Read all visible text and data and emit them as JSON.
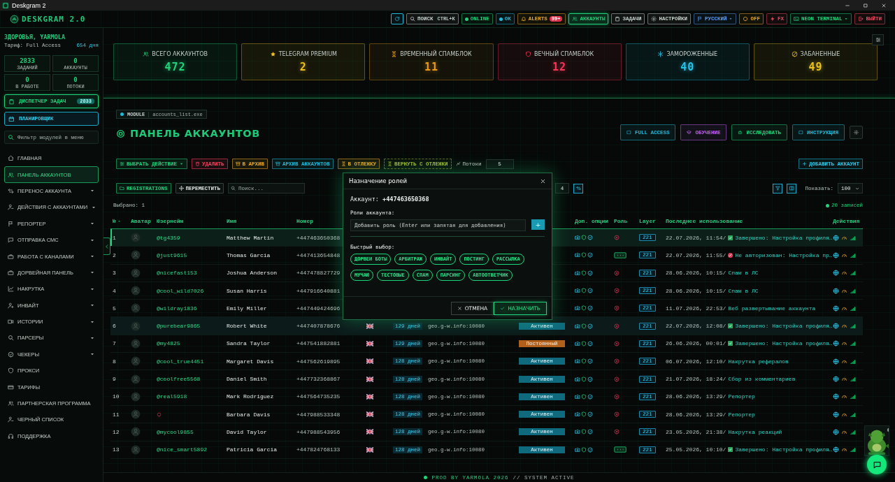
{
  "window": {
    "title": "Deskgram 2"
  },
  "header": {
    "logo": "DESKGRAM 2.0",
    "buttons": [
      {
        "color": "#22b8d8",
        "selected": false,
        "dropdown": false
      },
      {
        "label": "ПОИСК",
        "shortcut": "CTRL+K",
        "color": "#c8d2cd",
        "selected": false,
        "dropdown": false
      },
      {
        "label": "ONLINE",
        "color": "#22d07a",
        "selected": false,
        "dropdown": false
      },
      {
        "label": "OK",
        "color": "#22b8d8",
        "selected": false,
        "dropdown": false
      },
      {
        "label": "ALERTS",
        "badge": "99+",
        "color": "#e8a828",
        "selected": false,
        "dropdown": false
      },
      {
        "label": "АККАУНТЫ",
        "color": "#22d07a",
        "selected": true,
        "dropdown": false
      },
      {
        "label": "ЗАДАЧИ",
        "color": "#c8d2cd",
        "selected": false,
        "dropdown": false
      },
      {
        "label": "НАСТРОЙКИ",
        "color": "#c8d2cd",
        "selected": false,
        "dropdown": false
      },
      {
        "label": "РУССКИЙ",
        "color": "#5a9cf0",
        "selected": false,
        "dropdown": true
      },
      {
        "label": "OFF",
        "color": "#e8a828",
        "selected": false,
        "dropdown": false
      },
      {
        "label": "FX",
        "color": "#f04860",
        "selected": false,
        "dropdown": false
      },
      {
        "label": "NEON TERMINAL",
        "color": "#22d07a",
        "selected": false,
        "dropdown": true
      },
      {
        "label": "ВЫЙТИ",
        "color": "#f04860",
        "selected": false,
        "dropdown": false
      }
    ]
  },
  "sidebar": {
    "greeting": "ЗДОРОВЬЯ, YARMOLA",
    "plan": "Тариф: Full Access",
    "days_left": "654 дня",
    "stats": [
      {
        "value": "2833",
        "label": "ЗАДАНИЙ"
      },
      {
        "value": "0",
        "label": "АККАУНТЫ"
      },
      {
        "value": "0",
        "label": "В РАБОТЕ"
      },
      {
        "value": "0",
        "label": "ПОТОКИ"
      }
    ],
    "dispatcher": {
      "label": "ДИСПЕТЧЕР ЗАДАЧ",
      "badge": "2833"
    },
    "planner": {
      "label": "ПЛАНИРОВЩИК"
    },
    "filter": {
      "placeholder": "Фильтр модулей в меню"
    },
    "items": [
      {
        "label": "ГЛАВНАЯ",
        "selected": false,
        "has_submenu": false
      },
      {
        "label": "ПАНЕЛЬ АККАУНТОВ",
        "selected": true,
        "has_submenu": false
      },
      {
        "label": "ПЕРЕНОС АККАУНТА",
        "selected": false,
        "has_submenu": true
      },
      {
        "label": "ДЕЙСТВИЯ С АККАУНТАМИ",
        "selected": false,
        "has_submenu": true
      },
      {
        "label": "РЕПОРТЕР",
        "selected": false,
        "has_submenu": true
      },
      {
        "label": "ОТПРАВКА СМС",
        "selected": false,
        "has_submenu": true
      },
      {
        "label": "РАБОТА С КАНАЛАМИ",
        "selected": false,
        "has_submenu": true
      },
      {
        "label": "ДОРВЕЙНАЯ ПАНЕЛЬ",
        "selected": false,
        "has_submenu": true
      },
      {
        "label": "НАКРУТКА",
        "selected": false,
        "has_submenu": true
      },
      {
        "label": "ИНВАЙТ",
        "selected": false,
        "has_submenu": true
      },
      {
        "label": "ИСТОРИИ",
        "selected": false,
        "has_submenu": true
      },
      {
        "label": "ПАРСЕРЫ",
        "selected": false,
        "has_submenu": true
      },
      {
        "label": "ЧЕКЕРЫ",
        "selected": false,
        "has_submenu": true
      },
      {
        "label": "ПРОКСИ",
        "selected": false,
        "has_submenu": false
      },
      {
        "label": "ТАРИФЫ",
        "selected": false,
        "has_submenu": false
      },
      {
        "label": "ПАРТНЕРСКАЯ ПРОГРАММА",
        "selected": false,
        "has_submenu": false
      },
      {
        "label": "ЧЕРНЫЙ СПИСОК",
        "selected": false,
        "has_submenu": false
      },
      {
        "label": "ПОДДЕРЖКА",
        "selected": false,
        "has_submenu": false
      }
    ]
  },
  "stat_cards": [
    {
      "label": "ВСЕГО АККАУНТОВ",
      "value": "472",
      "color": "#1ed47a"
    },
    {
      "label": "TELEGRAM PREMIUM",
      "value": "2",
      "color": "#f0c020"
    },
    {
      "label": "ВРЕМЕННЫЙ СПАМБЛОК",
      "value": "11",
      "color": "#e89a18"
    },
    {
      "label": "ВЕЧНЫЙ СПАМБЛОК",
      "value": "12",
      "color": "#ff3355"
    },
    {
      "label": "ЗАМОРОЖЕННЫЕ",
      "value": "40",
      "color": "#22c4e8"
    },
    {
      "label": "ЗАБАНЕННЫЕ",
      "value": "49",
      "color": "#e8c020"
    }
  ],
  "panel": {
    "module_label": "MODULE",
    "module_file": "accounts_list.exe",
    "title": "ПАНЕЛЬ АККАУНТОВ",
    "actions": [
      {
        "label": "FULL ACCESS",
        "color": "#22b8d8"
      },
      {
        "label": "ОБУЧЕНИЕ",
        "color": "#c060f0"
      },
      {
        "label": "ИССЛЕДОВАТЬ",
        "color": "#22d07a"
      },
      {
        "label": "ИНСТРУКЦИЯ",
        "color": "#22b8d8"
      }
    ],
    "toolbar": [
      {
        "label": "ВЫБРАТЬ ДЕЙСТВИЕ",
        "color": "#22d07a",
        "disabled": false
      },
      {
        "label": "УДАЛИТЬ",
        "color": "#ff4060",
        "disabled": false
      },
      {
        "label": "В АРХИВ",
        "color": "#e8a828",
        "disabled": false
      },
      {
        "label": "АРХИВ АККАУНТОВ",
        "color": "#22b8d8",
        "disabled": false
      },
      {
        "label": "В ОТЛЕЖКУ",
        "color": "#e8a828",
        "disabled": false
      },
      {
        "label": "ВЕРНУТЬ С ОТЛЕЖКИ",
        "color": "#a0b830",
        "disabled": true
      }
    ],
    "threads_label": "Потоки",
    "threads_value": "5",
    "add_button": "ДОБАВИТЬ АККАУНТ",
    "folder_button": "REGISTRATIONS",
    "move_button": "ПЕРЕМЕСТИТЬ",
    "search_placeholder": "Поиск...",
    "page_value": "4",
    "show_label": "Показать:",
    "show_value": "100",
    "selected_count": "Выбрано: 1",
    "records": "20 записей"
  },
  "table": {
    "columns": [
      "№",
      "Аватар",
      "Юзернейм",
      "Имя",
      "Номер",
      "Доп. опции",
      "Роль",
      "Layer",
      "Последнее использование",
      "Действия"
    ],
    "rows": [
      {
        "number": "1",
        "username": "@tg4359",
        "name": "Matthew Martin",
        "phone": "+447463650368",
        "role_assigned": false,
        "layer": "221",
        "date": "22.07.2026, 11:54/",
        "task": {
          "kind": "done",
          "text": "Завершено: Настройка профиля…"
        },
        "selected": true,
        "hovered": false
      },
      {
        "number": "2",
        "username": "@just9615",
        "name": "Thomas Garcia",
        "phone": "+447413654848",
        "role_assigned": true,
        "layer": "221",
        "date": "22.07.2026, 11:55/",
        "task": {
          "kind": "error",
          "text": "Не авторизован: Настройка пр…"
        },
        "selected": false,
        "hovered": false
      },
      {
        "number": "3",
        "username": "@nicefast153",
        "name": "Joshua Anderson",
        "phone": "+447478827729",
        "role_assigned": false,
        "layer": "221",
        "date": "28.06.2026, 10:15/",
        "task": {
          "kind": "plain",
          "text": "Спам в ЛС"
        },
        "selected": false,
        "hovered": false
      },
      {
        "number": "4",
        "username": "@cool_wild7026",
        "name": "Susan Harris",
        "phone": "+447916640881",
        "role_assigned": false,
        "layer": "221",
        "date": "28.06.2026, 10:15/",
        "task": {
          "kind": "plain",
          "text": "Спам в ЛС"
        },
        "selected": false,
        "hovered": false
      },
      {
        "number": "5",
        "username": "@wildray1836",
        "name": "Emily Miller",
        "phone": "+447449424696",
        "role_assigned": false,
        "layer": "221",
        "date": "11.07.2026, 22:53/",
        "task": {
          "kind": "plain",
          "text": "Веб развертывание аккаунта"
        },
        "selected": false,
        "hovered": false
      },
      {
        "number": "6",
        "username": "@purebear9865",
        "name": "Robert White",
        "phone": "+447407878676",
        "days": "129 дней",
        "proxy": "geo.g-w.info:10080",
        "status": {
          "text": "Активен",
          "kind": "active"
        },
        "role_assigned": false,
        "layer": "221",
        "date": "22.07.2026, 12:08/",
        "task": {
          "kind": "done",
          "text": "Завершено: Настройка профиля…"
        },
        "selected": false,
        "hovered": true
      },
      {
        "number": "7",
        "username": "@my4825",
        "name": "Sandra Taylor",
        "phone": "+447541882881",
        "days": "129 дней",
        "proxy": "geo.g-w.info:10080",
        "status": {
          "text": "Постоянный",
          "kind": "permanent"
        },
        "role_assigned": false,
        "layer": "221",
        "date": "26.06.2026, 00:01/",
        "task": {
          "kind": "done",
          "text": "Завершено: Настройка профиля…"
        },
        "selected": false,
        "hovered": false
      },
      {
        "number": "8",
        "username": "@cool_true4451",
        "name": "Margaret Davis",
        "phone": "+447562619895",
        "days": "128 дней",
        "proxy": "geo.g-w.info:10080",
        "status": {
          "text": "Активен",
          "kind": "active"
        },
        "role_assigned": false,
        "layer": "221",
        "date": "06.07.2026, 12:10/",
        "task": {
          "kind": "plain",
          "text": "Накрутка рефералов"
        },
        "selected": false,
        "hovered": false
      },
      {
        "number": "9",
        "username": "@coolfree5568",
        "name": "Daniel Smith",
        "phone": "+447732368867",
        "days": "128 дней",
        "proxy": "geo.g-w.info:10080",
        "status": {
          "text": "Активен",
          "kind": "active"
        },
        "role_assigned": false,
        "layer": "221",
        "date": "21.07.2026, 18:24/",
        "task": {
          "kind": "plain",
          "text": "Сбор из комментариев"
        },
        "selected": false,
        "hovered": false
      },
      {
        "number": "10",
        "username": "@real5918",
        "name": "Mark Rodriguez",
        "phone": "+447564735235",
        "days": "128 дней",
        "proxy": "geo.g-w.info:10080",
        "status": {
          "text": "Активен",
          "kind": "active"
        },
        "role_assigned": false,
        "layer": "221",
        "date": "28.06.2026, 13:29/",
        "task": {
          "kind": "plain",
          "text": "Репортер"
        },
        "selected": false,
        "hovered": false
      },
      {
        "number": "11",
        "name": "Barbara Davis",
        "phone": "+447988533348",
        "days": "128 дней",
        "proxy": "geo.g-w.info:10080",
        "status": {
          "text": "Активен",
          "kind": "active"
        },
        "role_assigned": false,
        "layer": "221",
        "date": "28.06.2026, 13:29/",
        "task": {
          "kind": "plain",
          "text": "Репортер"
        },
        "selected": false,
        "hovered": false
      },
      {
        "number": "12",
        "username": "@mycool9855",
        "name": "David Taylor",
        "phone": "+447988543956",
        "days": "128 дней",
        "proxy": "geo.g-w.info:10080",
        "status": {
          "text": "Активен",
          "kind": "active"
        },
        "role_assigned": false,
        "layer": "221",
        "date": "23.05.2026, 21:38/",
        "task": {
          "kind": "plain",
          "text": "Накрутка реакций"
        },
        "selected": false,
        "hovered": false
      },
      {
        "number": "13",
        "username": "@nice_smart5892",
        "name": "Patricia Garcia",
        "phone": "+447824768133",
        "days": "128 дней",
        "proxy": "geo.g-w.info:10080",
        "status": {
          "text": "Активен",
          "kind": "active"
        },
        "role_assigned": true,
        "layer": "221",
        "date": "25.05.2026, 10:10/",
        "task": {
          "kind": "done",
          "text": "Завершено: Настройка профиля…"
        },
        "selected": false,
        "hovered": false
      }
    ]
  },
  "footer": {
    "credit": "PROD BY YARMOLA 2026",
    "status": "// SYSTEM ACTIVE"
  },
  "modal": {
    "title": "Назначение ролей",
    "account": "Аккаунт: **+447463650368**",
    "roles_label": "Роли аккаунта:",
    "role_placeholder": "Добавить роль (Enter или запятая для добавления)",
    "add": "+",
    "quick_label": "Быстрый выбор:",
    "chips": [
      "ДОРВЕИ БОТЫ",
      "АРБИТРАЖ",
      "ИНВАЙТ",
      "ПОСТИНГ",
      "РАССЫЛКА",
      "МУЧАЮ",
      "ТЕСТОВЫЕ",
      "СПАМ",
      "ПАРСИНГ",
      "АВТООТВЕТЧИК"
    ],
    "cancel": "ОТМЕНА",
    "confirm": "НАЗНАЧИТЬ"
  }
}
